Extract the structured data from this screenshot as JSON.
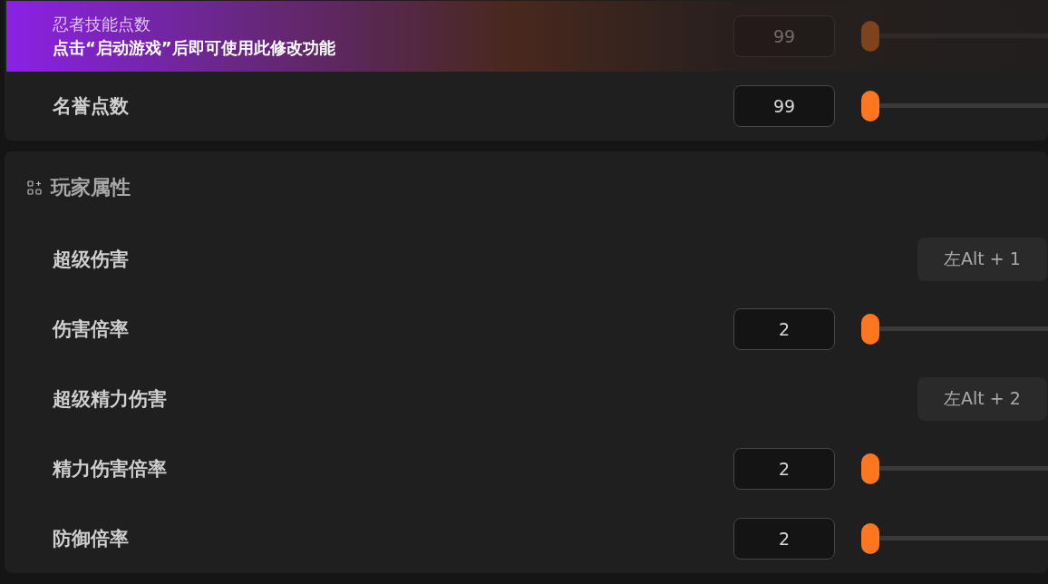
{
  "notice": {
    "title": "忍者技能点数",
    "message": "点击“启动游戏”后即可使用此修改功能"
  },
  "sections": [
    {
      "rows": [
        {
          "kind": "slider",
          "value": "99",
          "level": 0
        },
        {
          "kind": "slider",
          "label": "名誉点数",
          "value": "99",
          "level": 0
        }
      ]
    },
    {
      "header": "玩家属性",
      "rows": [
        {
          "kind": "hotkey",
          "label": "超级伤害",
          "hotkey": "左Alt + 1"
        },
        {
          "kind": "slider",
          "label": "伤害倍率",
          "value": "2",
          "level": 0
        },
        {
          "kind": "hotkey",
          "label": "超级精力伤害",
          "hotkey": "左Alt + 2"
        },
        {
          "kind": "slider",
          "label": "精力伤害倍率",
          "value": "2",
          "level": 0
        },
        {
          "kind": "slider",
          "label": "防御倍率",
          "value": "2",
          "level": 0
        }
      ]
    }
  ]
}
